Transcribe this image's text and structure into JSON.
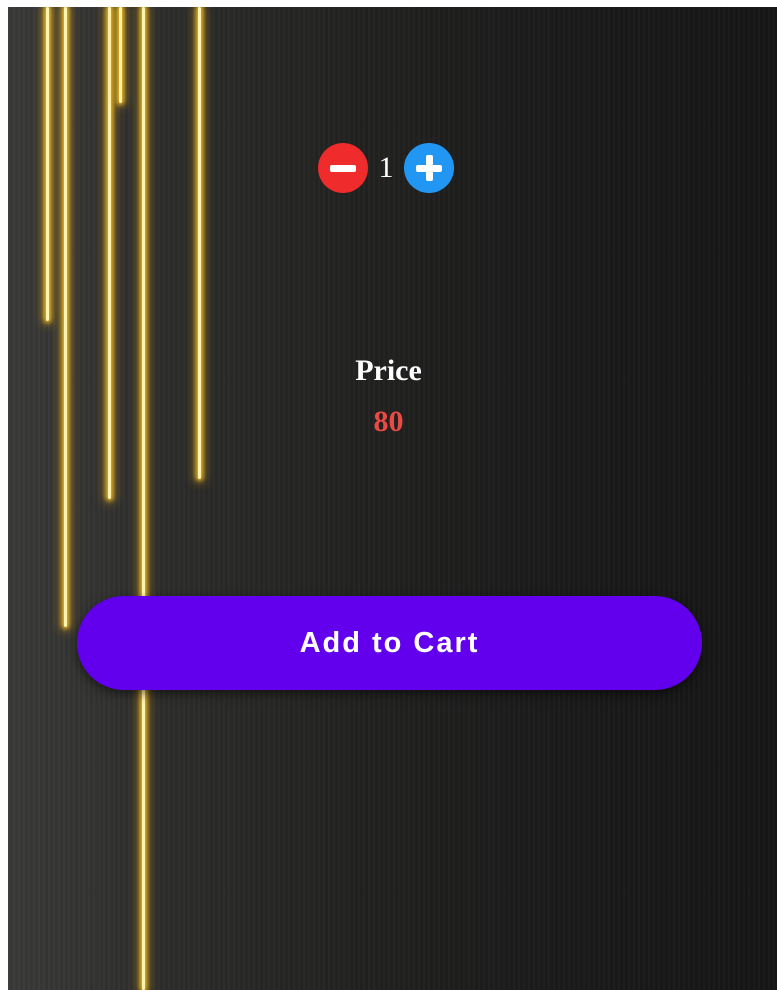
{
  "product": {
    "quantity": "1",
    "price_label": "Price",
    "price_value": "80"
  },
  "actions": {
    "add_to_cart_label": "Add to Cart"
  },
  "icons": {
    "decrement": "minus-circle-icon",
    "increment": "plus-circle-icon"
  },
  "colors": {
    "decrement_button": "#ef2b2b",
    "increment_button": "#2196f3",
    "price_value": "#ea4a44",
    "primary_button": "#6200ee"
  }
}
